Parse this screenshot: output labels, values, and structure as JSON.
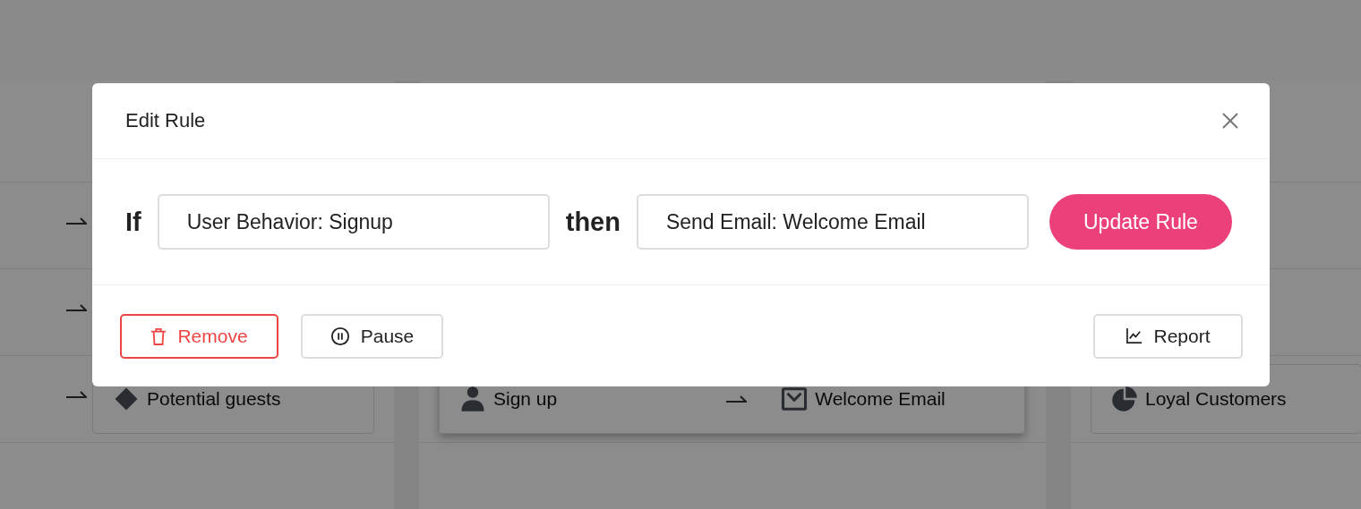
{
  "dialog": {
    "title": "Edit Rule",
    "condition_label": "If",
    "condition_value": "User Behavior: Signup",
    "action_label": "then",
    "action_value": "Send Email: Welcome Email",
    "submit": "Update Rule",
    "footer_buttons": [
      {
        "kind": "danger",
        "label": "Remove"
      },
      {
        "kind": "pause",
        "label": "Pause"
      },
      {
        "kind": "report",
        "label": "Report"
      }
    ]
  },
  "background": {
    "segment": "Potential guests",
    "trigger": "Sign up",
    "action": "Welcome Email",
    "audience": "Loyal Customers"
  }
}
